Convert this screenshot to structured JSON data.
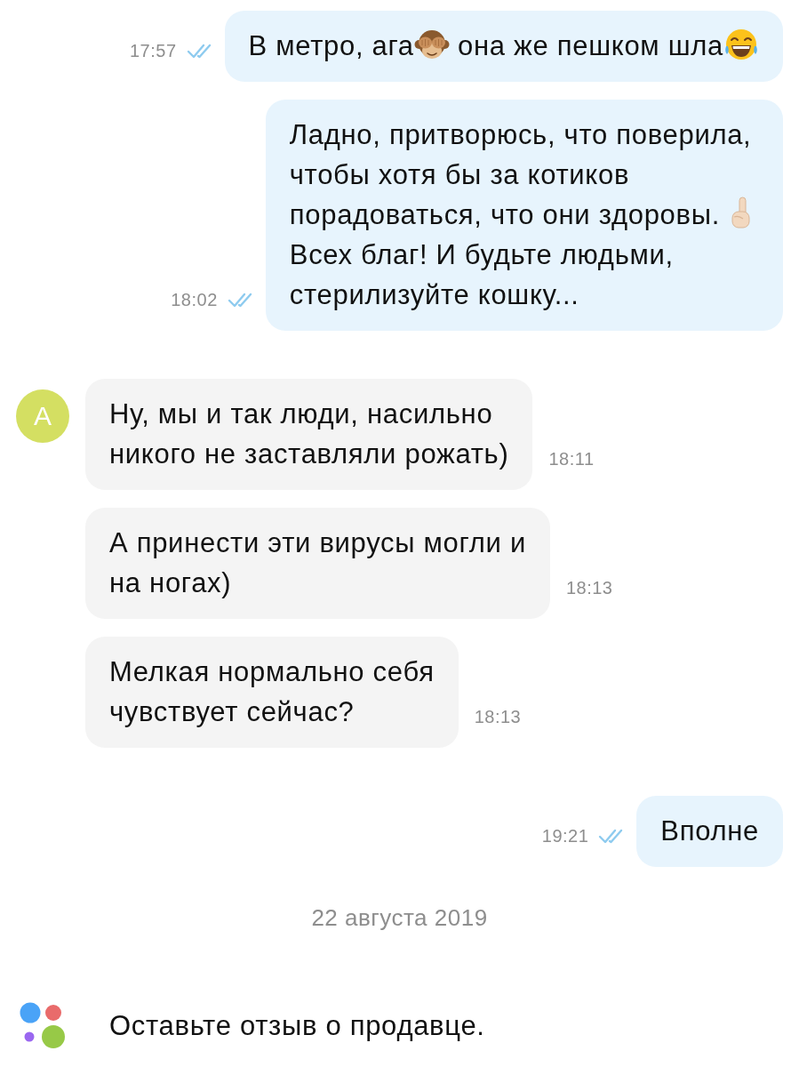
{
  "messages": [
    {
      "kind": "outgoing",
      "time": "17:57",
      "read": true,
      "lines": [
        [
          {
            "kind": "text",
            "text": "В метро, ага"
          },
          {
            "kind": "monkey"
          },
          {
            "kind": "text",
            "text": " она же пешком шла"
          },
          {
            "kind": "laugh"
          }
        ]
      ]
    },
    {
      "kind": "outgoing",
      "time": "18:02",
      "read": true,
      "lines": [
        [
          {
            "kind": "text",
            "text": "Ладно, притворюсь, что поверила,"
          }
        ],
        [
          {
            "kind": "text",
            "text": "чтобы хотя бы за котиков"
          }
        ],
        [
          {
            "kind": "text",
            "text": "порадоваться, что они здоровы."
          },
          {
            "kind": "finger"
          }
        ],
        [
          {
            "kind": "text",
            "text": "Всех благ! И будьте людьми,"
          }
        ],
        [
          {
            "kind": "text",
            "text": "стерилизуйте кошку..."
          }
        ]
      ]
    },
    {
      "kind": "incoming",
      "time": "18:11",
      "avatar": {
        "letter": "А"
      },
      "lines": [
        [
          {
            "kind": "text",
            "text": "Ну, мы и так люди, насильно"
          }
        ],
        [
          {
            "kind": "text",
            "text": "никого не заставляли рожать)"
          }
        ]
      ]
    },
    {
      "kind": "incoming",
      "time": "18:13",
      "lines": [
        [
          {
            "kind": "text",
            "text": "А принести эти вирусы могли и"
          }
        ],
        [
          {
            "kind": "text",
            "text": "на ногах)"
          }
        ]
      ]
    },
    {
      "kind": "incoming",
      "time": "18:13",
      "lines": [
        [
          {
            "kind": "text",
            "text": "Мелкая нормально себя"
          }
        ],
        [
          {
            "kind": "text",
            "text": "чувствует сейчас?"
          }
        ]
      ]
    },
    {
      "kind": "outgoing",
      "time": "19:21",
      "read": true,
      "lines": [
        [
          {
            "kind": "text",
            "text": "Вполне"
          }
        ]
      ]
    }
  ],
  "date_separator": "22 августа 2019",
  "notice": {
    "text": "Оставьте отзыв о продавце."
  }
}
